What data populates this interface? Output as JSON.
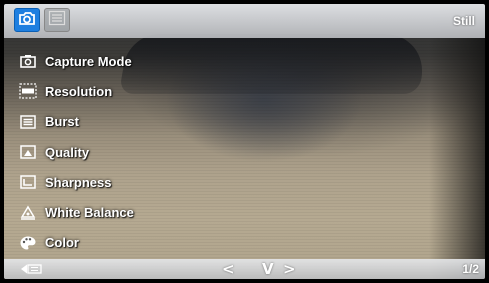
{
  "header": {
    "tabs": [
      {
        "icon": "camera-icon",
        "active": true
      },
      {
        "icon": "settings-list-icon",
        "active": false
      }
    ],
    "mode_label": "Still"
  },
  "menu": {
    "items": [
      {
        "label": "Capture Mode",
        "icon": "capture-mode-icon"
      },
      {
        "label": "Resolution",
        "icon": "resolution-size-icon"
      },
      {
        "label": "Burst",
        "icon": "burst-icon"
      },
      {
        "label": "Quality",
        "icon": "quality-icon"
      },
      {
        "label": "Sharpness",
        "icon": "sharpness-icon"
      },
      {
        "label": "White Balance",
        "icon": "white-balance-icon"
      },
      {
        "label": "Color",
        "icon": "color-palette-icon"
      }
    ]
  },
  "footer": {
    "back_icon": "back-icon",
    "nav_left": "<",
    "nav_down": "V",
    "nav_right": ">",
    "page": "1/2"
  },
  "colors": {
    "accent": "#1e7fe0",
    "bar": "#d8dadd",
    "text": "#ffffff"
  }
}
